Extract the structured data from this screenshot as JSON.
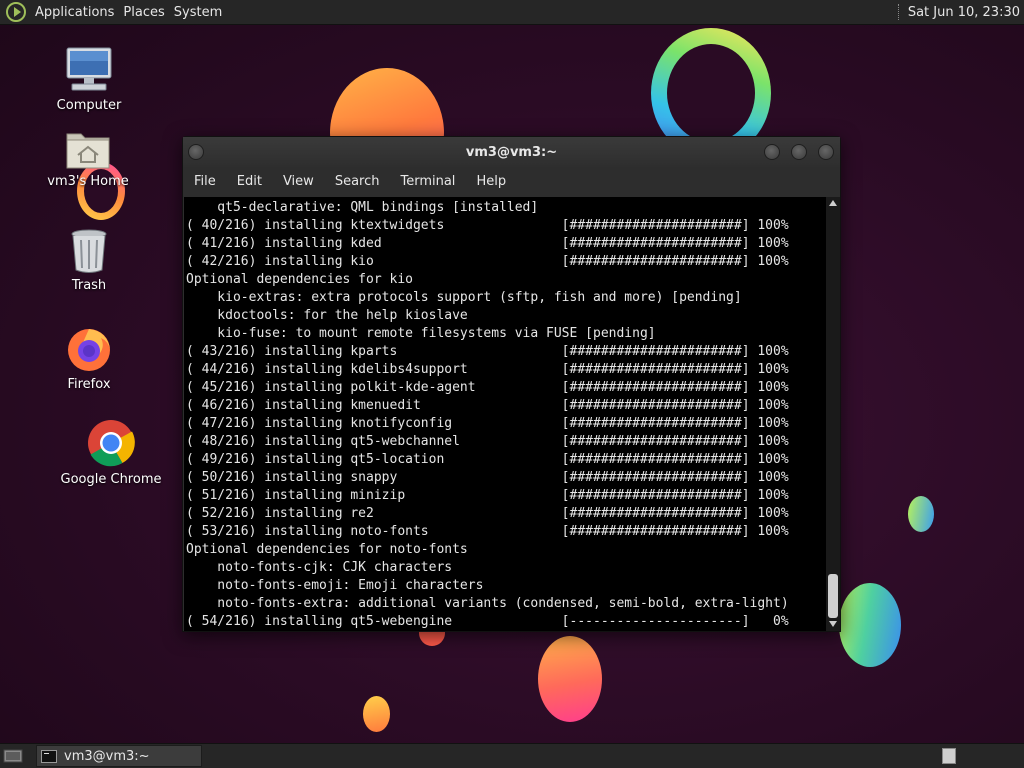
{
  "top_panel": {
    "menus": [
      "Applications",
      "Places",
      "System"
    ],
    "clock": "Sat Jun 10, 23:30"
  },
  "desktop_icons": {
    "computer": "Computer",
    "home": "vm3's Home",
    "trash": "Trash",
    "firefox": "Firefox",
    "chrome": "Google Chrome"
  },
  "terminal": {
    "title": "vm3@vm3:~",
    "menus": [
      "File",
      "Edit",
      "View",
      "Search",
      "Terminal",
      "Help"
    ],
    "lines": [
      "    qt5-declarative: QML bindings [installed]",
      "( 40/216) installing ktextwidgets               [######################] 100%",
      "( 41/216) installing kded                       [######################] 100%",
      "( 42/216) installing kio                        [######################] 100%",
      "Optional dependencies for kio",
      "    kio-extras: extra protocols support (sftp, fish and more) [pending]",
      "    kdoctools: for the help kioslave",
      "    kio-fuse: to mount remote filesystems via FUSE [pending]",
      "( 43/216) installing kparts                     [######################] 100%",
      "( 44/216) installing kdelibs4support            [######################] 100%",
      "( 45/216) installing polkit-kde-agent           [######################] 100%",
      "( 46/216) installing kmenuedit                  [######################] 100%",
      "( 47/216) installing knotifyconfig              [######################] 100%",
      "( 48/216) installing qt5-webchannel             [######################] 100%",
      "( 49/216) installing qt5-location               [######################] 100%",
      "( 50/216) installing snappy                     [######################] 100%",
      "( 51/216) installing minizip                    [######################] 100%",
      "( 52/216) installing re2                        [######################] 100%",
      "( 53/216) installing noto-fonts                 [######################] 100%",
      "Optional dependencies for noto-fonts",
      "    noto-fonts-cjk: CJK characters",
      "    noto-fonts-emoji: Emoji characters",
      "    noto-fonts-extra: additional variants (condensed, semi-bold, extra-light)",
      "( 54/216) installing qt5-webengine              [----------------------]   0%"
    ]
  },
  "taskbar": {
    "task_label": "vm3@vm3:~"
  },
  "colors": {
    "panel_bg": "#262626",
    "terminal_bg": "#000000",
    "desktop_bg": "#2a0b24"
  }
}
